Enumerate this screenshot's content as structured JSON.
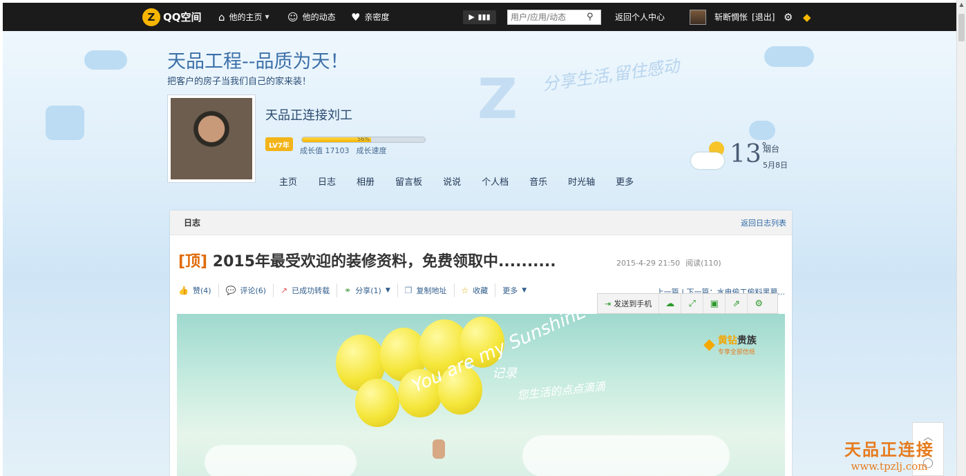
{
  "topbar": {
    "logo_text": "QQ空间",
    "nav": [
      {
        "icon": "home-icon",
        "label": "他的主页",
        "has_caret": true
      },
      {
        "icon": "user-icon",
        "label": "他的动态"
      },
      {
        "icon": "heart-icon",
        "label": "亲密度"
      }
    ],
    "search_placeholder": "用户/应用/动态",
    "back_center": "返回个人中心",
    "username": "斩断惆怅",
    "logout": "[退出]"
  },
  "header": {
    "space_title": "天品工程--品质为天！",
    "space_subtitle": "把客户的房子当我们自己的家来装！",
    "slogan": "分享生活,留住感动",
    "owner_name": "天品正连接刘工",
    "level_badge": "LV7年",
    "progress_pct_text": "56%",
    "progress_value": 0.56,
    "growth_value": "成长值 17103",
    "growth_speed": "成长速度",
    "weather": {
      "temp": "13",
      "unit": "°",
      "city": "烟台",
      "date": "5月8日"
    },
    "nav": [
      "主页",
      "日志",
      "相册",
      "留言板",
      "说说",
      "个人档",
      "音乐",
      "时光轴",
      "更多"
    ]
  },
  "card": {
    "section_title": "日志",
    "back_to_list": "返回日志列表",
    "post_tag": "[顶]",
    "post_title": "2015年最受欢迎的装修资料，免费领取中..........",
    "post_time": "2015-4-29 21:50",
    "post_reads": "阅读(110)",
    "actions": [
      {
        "icon": "thumbs-up-icon",
        "label": "赞(4)"
      },
      {
        "icon": "comment-icon",
        "label": "评论(6)"
      },
      {
        "icon": "repost-icon",
        "label": "已成功转载"
      },
      {
        "icon": "share-icon",
        "label": "分享(1)",
        "has_caret": true
      },
      {
        "icon": "copy-icon",
        "label": "复制地址"
      },
      {
        "icon": "star-icon",
        "label": "收藏"
      },
      {
        "icon": "more-icon",
        "label": "更多",
        "has_caret": true
      }
    ],
    "prev_next": "上一篇 | 下一篇：水电偷工偷料黑幕...",
    "float_bar_send": "发送到手机",
    "banner": {
      "script_text": "You are my SunshinE",
      "line1": "记录",
      "line2": "您生活的点点滴滴",
      "vip_title_gold": "黄钻",
      "vip_title_rest": "贵族",
      "vip_sub": "专享全部信纸"
    }
  },
  "watermark": {
    "line1": "天品正连接",
    "line2": "www.tpzlj.com"
  }
}
